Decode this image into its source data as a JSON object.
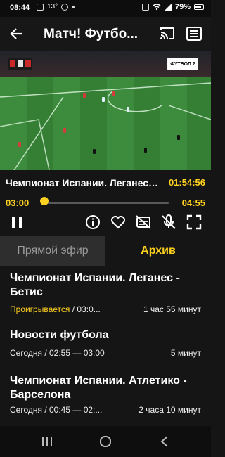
{
  "status_bar": {
    "time": "08:44",
    "temperature": "13°",
    "battery": "79%"
  },
  "app_bar": {
    "title": "Матч! Футбо..."
  },
  "player": {
    "now_playing_title": "Чемпионат Испании. Леганес - Бетис",
    "current_clock": "01:54:56",
    "progress_start": "03:00",
    "progress_end": "04:55",
    "progress_fraction": 0.03,
    "overlay_channel": "ФУТБОЛ 2"
  },
  "tabs": {
    "live_label": "Прямой эфир",
    "archive_label": "Архив",
    "active": "archive"
  },
  "archive_list": [
    {
      "title_line1": "Чемпионат Испании. Леганес -",
      "title_line2": "Бетис",
      "status": "Проигрывается",
      "meta": " / 03:0...",
      "duration": "1 час 55 минут"
    },
    {
      "title_line1": "Новости футбола",
      "title_line2": "",
      "status": "",
      "meta": "Сегодня / 02:55 — 03:00",
      "duration": "5 минут"
    },
    {
      "title_line1": "Чемпионат Испании. Атлетико -",
      "title_line2": "Барселона",
      "status": "",
      "meta": "Сегодня / 00:45 — 02:...",
      "duration": "2 часа 10 минут"
    }
  ],
  "colors": {
    "accent": "#ffd21f",
    "background": "#151515",
    "tab_inactive": "#2e2e2e"
  }
}
